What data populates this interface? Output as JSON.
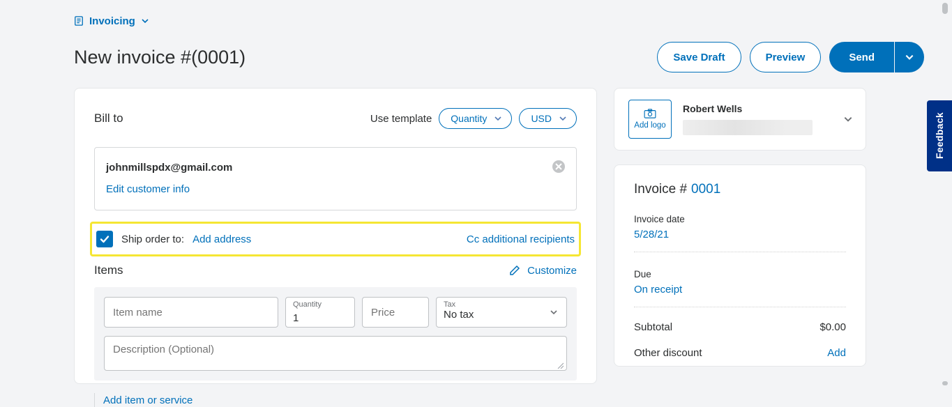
{
  "breadcrumb": {
    "label": "Invoicing"
  },
  "page_title": "New invoice #(0001)",
  "header_actions": {
    "save_draft": "Save Draft",
    "preview": "Preview",
    "send": "Send"
  },
  "billTo": {
    "section_label": "Bill to",
    "template_label": "Use template",
    "quantity_pill": "Quantity",
    "currency_pill": "USD"
  },
  "customer": {
    "email": "johnmillspdx@gmail.com",
    "edit_link": "Edit customer info"
  },
  "ship": {
    "label": "Ship order to:",
    "add_address": "Add address",
    "cc_link": "Cc additional recipients"
  },
  "items": {
    "section_label": "Items",
    "customize": "Customize",
    "name_placeholder": "Item name",
    "quantity_label": "Quantity",
    "quantity_value": "1",
    "price_placeholder": "Price",
    "tax_label": "Tax",
    "tax_value": "No tax",
    "description_placeholder": "Description (Optional)",
    "add_item": "Add item or service"
  },
  "user": {
    "name": "Robert Wells",
    "logo_button": "Add logo"
  },
  "summary": {
    "invoice_prefix": "Invoice #",
    "invoice_number": "0001",
    "date_label": "Invoice date",
    "date_value": "5/28/21",
    "due_label": "Due",
    "due_value": "On receipt",
    "subtotal_label": "Subtotal",
    "subtotal_value": "$0.00",
    "discount_label": "Other discount",
    "discount_action": "Add"
  },
  "feedback": "Feedback"
}
